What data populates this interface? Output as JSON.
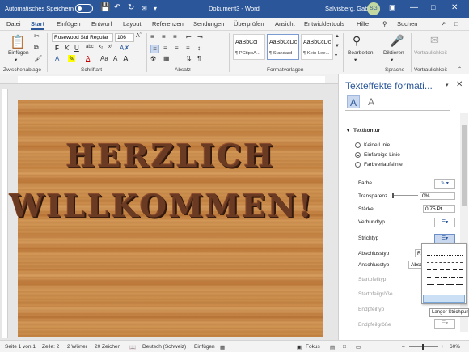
{
  "titlebar": {
    "autosave": "Automatisches Speichern",
    "document": "Dokument3 - Word",
    "user": "Salvisberg, Gaby",
    "initials": "SG"
  },
  "tabs": [
    "Datei",
    "Start",
    "Einfügen",
    "Entwurf",
    "Layout",
    "Referenzen",
    "Sendungen",
    "Überprüfen",
    "Ansicht",
    "Entwicklertools",
    "Hilfe"
  ],
  "search_label": "Suchen",
  "ribbon": {
    "paste": "Einfügen",
    "clipboard": "Zwischenablage",
    "font_name": "Rosewood Std Regular",
    "font_size": "106",
    "font_group": "Schriftart",
    "paragraph_group": "Absatz",
    "styles_group": "Formatvorlagen",
    "styles": [
      {
        "sample": "AaBbCcI",
        "name": "¶ PCtippA..."
      },
      {
        "sample": "AaBbCcDc",
        "name": "¶ Standard"
      },
      {
        "sample": "AaBbCcDc",
        "name": "¶ Kein Lee..."
      }
    ],
    "edit": "Bearbeiten",
    "dictate": "Diktieren",
    "speech": "Sprache",
    "confidential": "Vertraulichkeit",
    "confidential_group": "Vertraulichkeit"
  },
  "document": {
    "line1": "HERZLICH",
    "line2": "WILLKOMMEN!"
  },
  "pane": {
    "title": "Texteffekte formati...",
    "section": "Textkontur",
    "radio_none": "Keine Linie",
    "radio_solid": "Einfarbige Linie",
    "radio_gradient": "Farbverlaufslinie",
    "color": "Farbe",
    "transparency": "Transparenz",
    "transparency_value": "0%",
    "width": "Stärke",
    "width_value": "0.75 Pt.",
    "compound": "Verbundtyp",
    "dash": "Strichtyp",
    "cap": "Abschlusstyp",
    "cap_value": "Ru",
    "join": "Anschlusstyp",
    "join_value": "Absch",
    "begin_arrow": "Startpfeiltyp",
    "begin_size": "Startpfeilgröße",
    "end_arrow": "Endpfeiltyp",
    "end_size": "Endpfeilgröße",
    "tooltip": "Langer Strichpunkt-Punkt"
  },
  "status": {
    "page": "Seite 1 von 1",
    "line": "Zeile: 2",
    "words": "2 Wörter",
    "chars": "20 Zeichen",
    "lang": "Deutsch (Schweiz)",
    "mode": "Einfügen",
    "focus": "Fokus",
    "zoom": "60%"
  }
}
